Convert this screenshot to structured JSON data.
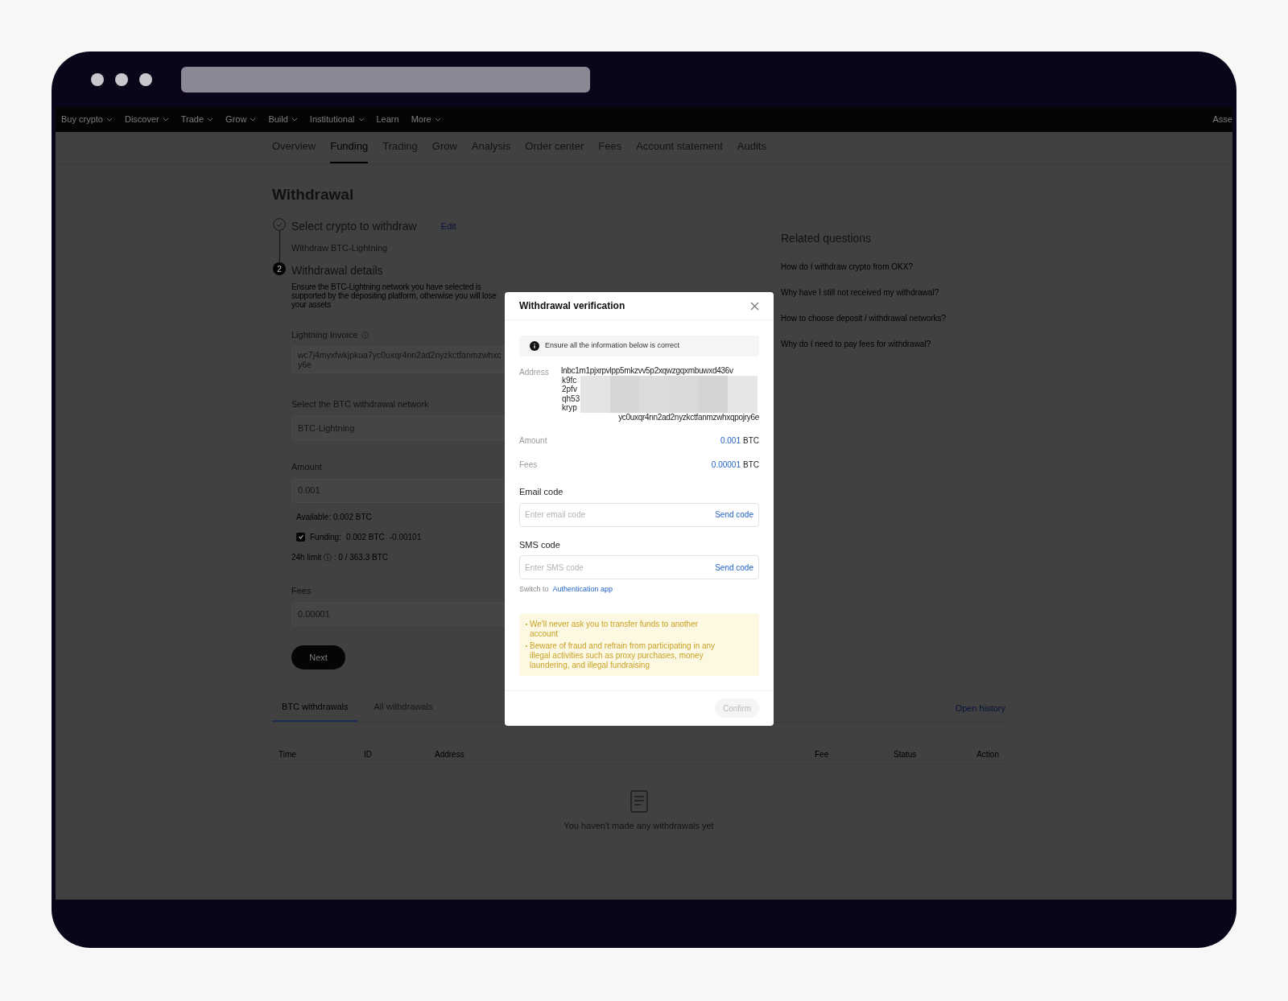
{
  "nav": {
    "items": [
      {
        "label": "Buy crypto",
        "dropdown": true
      },
      {
        "label": "Discover",
        "dropdown": true
      },
      {
        "label": "Trade",
        "dropdown": true
      },
      {
        "label": "Grow",
        "dropdown": true
      },
      {
        "label": "Build",
        "dropdown": true
      },
      {
        "label": "Institutional",
        "dropdown": true
      },
      {
        "label": "Learn",
        "dropdown": false
      },
      {
        "label": "More",
        "dropdown": true
      }
    ],
    "right_item": "Asse"
  },
  "tabs": [
    {
      "label": "Overview",
      "selected": false
    },
    {
      "label": "Funding",
      "selected": true
    },
    {
      "label": "Trading",
      "selected": false
    },
    {
      "label": "Grow",
      "selected": false
    },
    {
      "label": "Analysis",
      "selected": false
    },
    {
      "label": "Order center",
      "selected": false
    },
    {
      "label": "Fees",
      "selected": false
    },
    {
      "label": "Account statement",
      "selected": false
    },
    {
      "label": "Audits",
      "selected": false
    }
  ],
  "page_title": "Withdrawal",
  "steps": [
    {
      "title": "Select crypto to withdraw",
      "done": true,
      "action": "Edit",
      "subtitle": "Withdraw BTC-Lightning"
    },
    {
      "title": "Withdrawal details",
      "done": false,
      "number": "2",
      "subtitle": "Ensure the BTC-Lightning network you have selected is supported by the depositing platform, otherwise you will lose your assets"
    }
  ],
  "form": {
    "invoice_label": "Lightning Invoice",
    "invoice_value": "wc7j4myxfwkjpkua7yc0uxqr4nn2ad2nyzkctfanmzwhxc",
    "invoice_value_2": "y6e",
    "network_label": "Select the BTC withdrawal network",
    "network_value": "BTC-Lightning",
    "amount_label": "Amount",
    "amount_value": "0.001",
    "available": "Available: 0.002 BTC",
    "funding": {
      "label": "Funding:",
      "amount": "0.002 BTC",
      "change": "-0.00101",
      "checked": true
    },
    "limit": "24h limit ⓘ : 0 / 363.3 BTC",
    "fees_label": "Fees",
    "fees_value": "0.00001",
    "next_button": "Next"
  },
  "related": {
    "title": "Related questions",
    "items": [
      "How do I withdraw crypto from OKX?",
      "Why have I still not received my withdrawal?",
      "How to choose deposit / withdrawal networks?",
      "Why do I need to pay fees for withdrawal?"
    ]
  },
  "history": {
    "tabs": [
      {
        "label": "BTC withdrawals",
        "selected": true
      },
      {
        "label": "All withdrawals",
        "selected": false
      }
    ],
    "open_history": "Open history",
    "columns": [
      "Time",
      "ID",
      "Address",
      "Fee",
      "Status",
      "Action"
    ],
    "empty": "You haven't made any withdrawals yet"
  },
  "modal": {
    "title": "Withdrawal verification",
    "notice": "Ensure all the information below is correct",
    "address_label": "Address",
    "address_lines": [
      "lnbc1m1pjxrpvlpp5mkzvv5p2xqwzgqxmbuwxd436v",
      "k9fc",
      "2pfv",
      "qh53",
      "kryp"
    ],
    "address_last": "yc0uxqr4nn2ad2nyzkctfanmzwhxqpojry6e",
    "amount_label": "Amount",
    "amount_value": "0.001",
    "amount_unit": "BTC",
    "fees_label": "Fees",
    "fees_value": "0.00001",
    "fees_unit": "BTC",
    "email_label": "Email code",
    "email_placeholder": "Enter email code",
    "email_send": "Send code",
    "sms_label": "SMS code",
    "sms_placeholder": "Enter SMS code",
    "sms_send": "Send code",
    "switch_text": "Switch to",
    "switch_link": "Authentication app",
    "warnings": [
      "We'll never ask you to transfer funds to another account",
      "Beware of fraud and refrain from participating in any illegal activities such as proxy purchases, money laundering, and illegal fundraising"
    ],
    "confirm": {
      "label": "Confirm",
      "disabled": true
    }
  }
}
